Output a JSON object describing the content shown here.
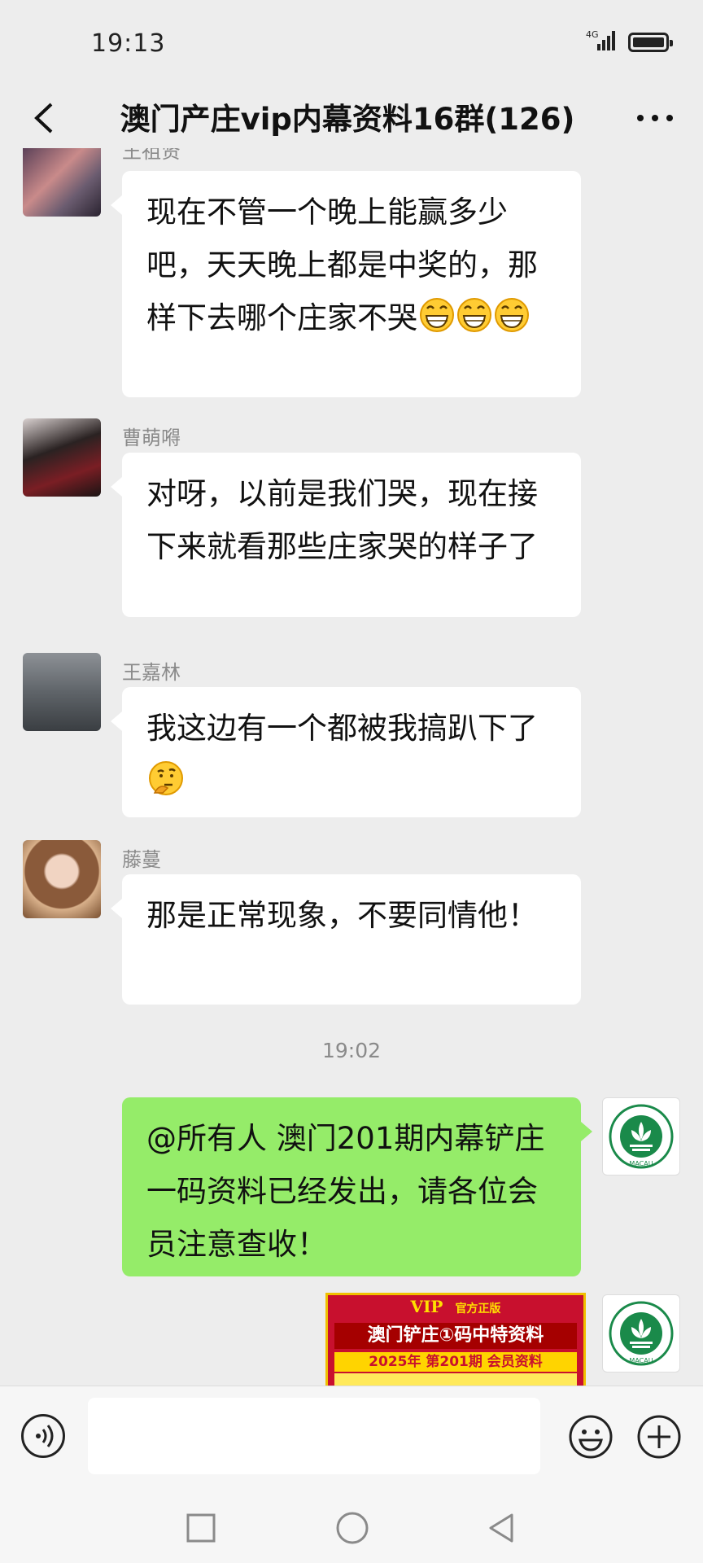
{
  "status_bar": {
    "time": "19:13",
    "network": "4G"
  },
  "header": {
    "title": "澳门产庄vip内幕资料16群(126)"
  },
  "messages": [
    {
      "sender": "王祖贤",
      "text": "现在不管一个晚上能赢多少吧，天天晚上都是中奖的，那样下去哪个庄家不哭",
      "emoji": [
        "grin-icon",
        "grin-icon",
        "grin-icon"
      ]
    },
    {
      "sender": "曹萌嘚",
      "text": "对呀，以前是我们哭，现在接下来就看那些庄家哭的样子了"
    },
    {
      "sender": "王嘉林",
      "text": "我这边有一个都被我搞趴下了",
      "emoji": [
        "thinking-icon"
      ]
    },
    {
      "sender": "藤蔓",
      "text": "那是正常现象，不要同情他！"
    }
  ],
  "timestamp": "19:02",
  "outgoing": {
    "text": "@所有人 澳门201期内幕铲庄一码资料已经发出，请各位会员注意查收！",
    "image": {
      "top_label": "VIP",
      "sub_label": "官方正版",
      "headline": "澳门铲庄①码中特资料",
      "issue_line": "2025年 第201期 会员资料"
    },
    "avatar_label": "MACAU"
  },
  "colors": {
    "bubble_out": "#95ec69",
    "bubble_in": "#ffffff",
    "background": "#ededed"
  }
}
